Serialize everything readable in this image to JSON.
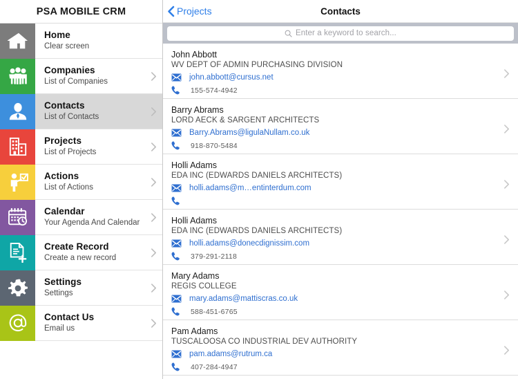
{
  "sidebar": {
    "title": "PSA MOBILE CRM",
    "items": [
      {
        "label": "Home",
        "sub": "Clear screen",
        "icon": "home-icon",
        "color": "#7c7c7c",
        "chevron": false,
        "selected": false
      },
      {
        "label": "Companies",
        "sub": "List of Companies",
        "icon": "group-icon",
        "color": "#35a745",
        "chevron": true,
        "selected": false
      },
      {
        "label": "Contacts",
        "sub": "List of Contacts",
        "icon": "person-icon",
        "color": "#3d8fdd",
        "chevron": true,
        "selected": true
      },
      {
        "label": "Projects",
        "sub": "List of Projects",
        "icon": "buildings-icon",
        "color": "#e8453c",
        "chevron": true,
        "selected": false
      },
      {
        "label": "Actions",
        "sub": "List of Actions",
        "icon": "task-person-icon",
        "color": "#f7cf3c",
        "chevron": true,
        "selected": false
      },
      {
        "label": "Calendar",
        "sub": "Your Agenda And Calendar",
        "icon": "calendar-icon",
        "color": "#8257a0",
        "chevron": true,
        "selected": false
      },
      {
        "label": "Create Record",
        "sub": "Create a new record",
        "icon": "new-document-icon",
        "color": "#0fa6a6",
        "chevron": true,
        "selected": false
      },
      {
        "label": "Settings",
        "sub": "Settings",
        "icon": "gear-icon",
        "color": "#5c6672",
        "chevron": true,
        "selected": false
      },
      {
        "label": "Contact Us",
        "sub": "Email us",
        "icon": "at-sign-icon",
        "color": "#a9c417",
        "chevron": true,
        "selected": false
      }
    ]
  },
  "navbar": {
    "back_label": "Projects",
    "back_icon": "chevron-left-icon",
    "title": "Contacts"
  },
  "search": {
    "icon": "search-icon",
    "value": "",
    "placeholder": "Enter a keyword to search..."
  },
  "contacts": {
    "email_icon": "envelope-icon",
    "phone_icon": "phone-icon",
    "chevron_icon": "chevron-right-icon",
    "rows": [
      {
        "name": "John Abbott",
        "company": "WV DEPT OF ADMIN PURCHASING DIVISION",
        "email": "john.abbott@cursus.net",
        "phone": "155-574-4942"
      },
      {
        "name": "Barry Abrams",
        "company": "LORD AECK & SARGENT ARCHITECTS",
        "email": "Barry.Abrams@ligulaNullam.co.uk",
        "phone": "918-870-5484"
      },
      {
        "name": "Holli Adams",
        "company": "EDA INC (EDWARDS DANIELS ARCHITECTS)",
        "email": "holli.adams@m…entinterdum.com",
        "phone": ""
      },
      {
        "name": "Holli Adams",
        "company": "EDA INC (EDWARDS DANIELS ARCHITECTS)",
        "email": "holli.adams@donecdignissim.com",
        "phone": "379-291-2118"
      },
      {
        "name": "Mary Adams",
        "company": "REGIS COLLEGE",
        "email": "mary.adams@mattiscras.co.uk",
        "phone": "588-451-6765"
      },
      {
        "name": "Pam Adams",
        "company": "TUSCALOOSA CO INDUSTRIAL DEV AUTHORITY",
        "email": "pam.adams@rutrum.ca",
        "phone": "407-284-4947"
      }
    ]
  },
  "colors": {
    "link": "#2f6fd0",
    "nav_link": "#2f7fe8",
    "search_bar_bg": "#bcc0c9",
    "selected_row": "#d8d8d8"
  }
}
